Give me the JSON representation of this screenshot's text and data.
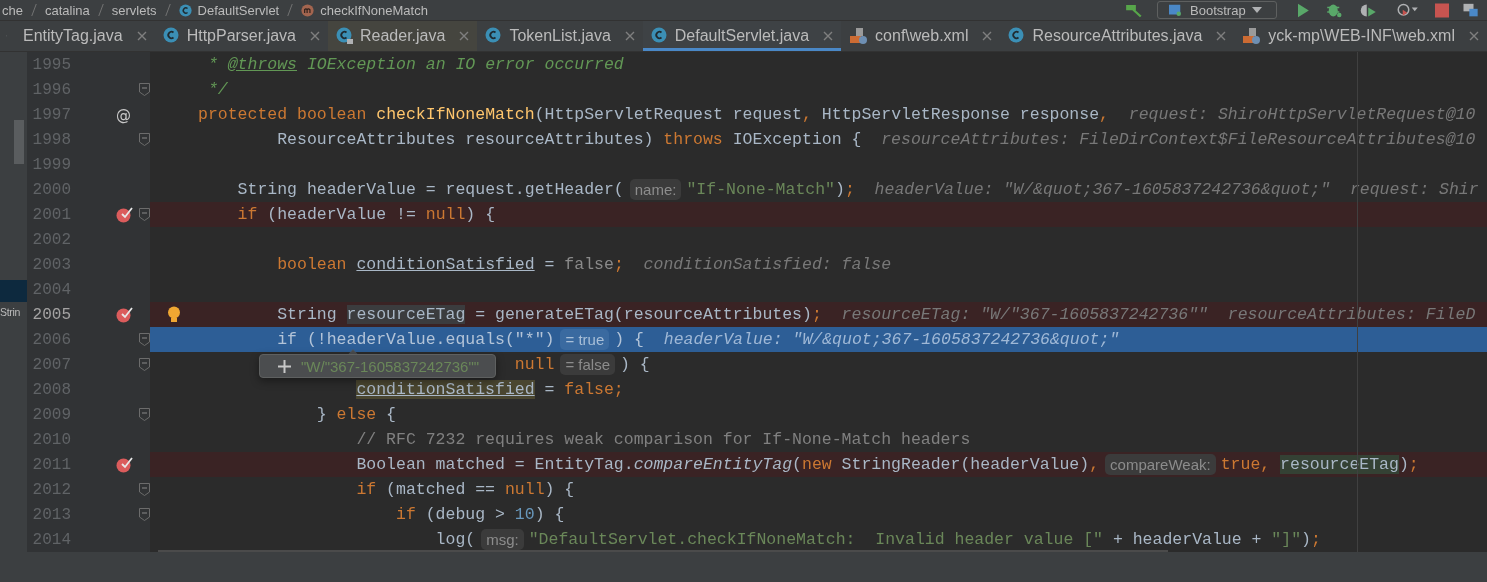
{
  "breadcrumb": [
    {
      "label": "che",
      "kind": "package"
    },
    {
      "label": "catalina",
      "kind": "package"
    },
    {
      "label": "servlets",
      "kind": "package"
    },
    {
      "label": "DefaultServlet",
      "kind": "class"
    },
    {
      "label": "checkIfNoneMatch",
      "kind": "method"
    }
  ],
  "run_config": {
    "label": "Bootstrap"
  },
  "tabs": [
    {
      "label": "EntityTag.java",
      "selected": false,
      "color": "#3c3f41"
    },
    {
      "label": "HttpParser.java",
      "kind": "class",
      "selected": false,
      "color": "#3c3f41"
    },
    {
      "label": "Reader.java",
      "kind": "class-locked",
      "selected": false,
      "color": "#45453f"
    },
    {
      "label": "TokenList.java",
      "kind": "class",
      "selected": false,
      "color": "#3c3f41"
    },
    {
      "label": "DefaultServlet.java",
      "kind": "class",
      "selected": true,
      "color": "#3e4245"
    },
    {
      "label": "conf\\web.xml",
      "kind": "xml",
      "selected": false,
      "color": "#3c3f41"
    },
    {
      "label": "ResourceAttributes.java",
      "kind": "class",
      "selected": false,
      "color": "#3c3f41"
    },
    {
      "label": "yck-mp\\WEB-INF\\web.xml",
      "kind": "xml",
      "selected": false,
      "color": "#3c3f41"
    }
  ],
  "side_panel": {
    "text": "Strin"
  },
  "lines": [
    {
      "number": "1995",
      "breakpoint": false,
      "current": false,
      "caret": false,
      "fold": false,
      "bulb": false,
      "tokens": [
        {
          "text": " * ",
          "kind": "doc"
        },
        {
          "text": "@throws",
          "kind": "doctag"
        },
        {
          "text": " IOException an IO error occurred",
          "kind": "doc"
        }
      ]
    },
    {
      "number": "1996",
      "breakpoint": false,
      "current": false,
      "caret": false,
      "fold": true,
      "bulb": false,
      "tokens": [
        {
          "text": " */",
          "kind": "doc"
        }
      ]
    },
    {
      "number": "1997",
      "marker": "@",
      "breakpoint": false,
      "current": false,
      "caret": false,
      "fold": false,
      "bulb": false,
      "tokens": [
        {
          "text": "protected boolean ",
          "kind": "kw"
        },
        {
          "text": "checkIfNoneMatch",
          "kind": "fn"
        },
        {
          "text": "(HttpServletRequest request",
          "kind": "plain"
        },
        {
          "text": ",",
          "kind": "kw"
        },
        {
          "text": " HttpServletResponse response",
          "kind": "plain"
        },
        {
          "text": ",",
          "kind": "kw"
        },
        {
          "text": "request: ShiroHttpServletRequest@10",
          "kind": "hint"
        }
      ]
    },
    {
      "number": "1998",
      "breakpoint": false,
      "current": false,
      "caret": false,
      "fold": true,
      "bulb": false,
      "tokens": [
        {
          "text": "        ResourceAttributes resourceAttributes) ",
          "kind": "plain"
        },
        {
          "text": "throws",
          "kind": "kw"
        },
        {
          "text": " IOException {",
          "kind": "plain"
        },
        {
          "text": "resourceAttributes: FileDirContext$FileResourceAttributes@10",
          "kind": "hint"
        }
      ]
    },
    {
      "number": "1999",
      "breakpoint": false,
      "current": false,
      "caret": false,
      "fold": false,
      "bulb": false
    },
    {
      "number": "2000",
      "breakpoint": false,
      "current": false,
      "caret": false,
      "fold": false,
      "bulb": false,
      "tokens": [
        {
          "text": "    String headerValue = request.getHeader(",
          "kind": "plain"
        },
        {
          "text": "name:",
          "kind": "inlay"
        },
        {
          "text": "\"If-None-Match\"",
          "kind": "str"
        },
        {
          "text": ")",
          "kind": "plain"
        },
        {
          "text": ";",
          "kind": "kw"
        },
        {
          "text": "headerValue: \"W/&quot;367-1605837242736&quot;\"",
          "kind": "hint"
        },
        {
          "text": "request: Shir",
          "kind": "hint"
        }
      ]
    },
    {
      "number": "2001",
      "breakpoint": true,
      "current": false,
      "caret": false,
      "fold": true,
      "bulb": false,
      "tokens": [
        {
          "text": "    if",
          "kind": "kw"
        },
        {
          "text": " (headerValue != ",
          "kind": "plain"
        },
        {
          "text": "null",
          "kind": "kw"
        },
        {
          "text": ") {",
          "kind": "plain"
        }
      ]
    },
    {
      "number": "2002",
      "breakpoint": false,
      "current": false,
      "caret": false,
      "fold": false,
      "bulb": false
    },
    {
      "number": "2003",
      "breakpoint": false,
      "current": false,
      "caret": false,
      "fold": false,
      "bulb": false,
      "tokens": [
        {
          "text": "        boolean ",
          "kind": "kw"
        },
        {
          "text": "conditionSatisfied",
          "kind": "var"
        },
        {
          "text": " = ",
          "kind": "plain"
        },
        {
          "text": "false",
          "kind": "dim"
        },
        {
          "text": ";",
          "kind": "kw"
        },
        {
          "text": "conditionSatisfied: false",
          "kind": "hint"
        }
      ]
    },
    {
      "number": "2004",
      "breakpoint": false,
      "current": false,
      "caret": false,
      "fold": false,
      "bulb": false
    },
    {
      "number": "2005",
      "breakpoint": true,
      "current": false,
      "caret": true,
      "fold": false,
      "bulb": true,
      "tokens": [
        {
          "text": "        String ",
          "kind": "plain"
        },
        {
          "text": "resourceETag",
          "kind": "selvar"
        },
        {
          "text": " = generateETag(resourceAttributes)",
          "kind": "plain"
        },
        {
          "text": ";",
          "kind": "kw"
        },
        {
          "text": "resourceETag: \"W/\"367-1605837242736\"\"",
          "kind": "hint"
        },
        {
          "text": "resourceAttributes: FileD",
          "kind": "hint"
        }
      ]
    },
    {
      "number": "2006",
      "breakpoint": false,
      "current": true,
      "caret": false,
      "fold": true,
      "bulb": false,
      "tokens": [
        {
          "text": "        if",
          "kind": "kw"
        },
        {
          "text": " (!headerValue.equals(",
          "kind": "plain"
        },
        {
          "text": "\"*\"",
          "kind": "str"
        },
        {
          "text": ")",
          "kind": "plain"
        },
        {
          "text": "= true",
          "kind": "inlay"
        },
        {
          "text": ") {",
          "kind": "plain"
        },
        {
          "text": "headerValue: \"W/&quot;367-1605837242736&quot;\"",
          "kind": "hint"
        }
      ]
    },
    {
      "number": "2007",
      "breakpoint": false,
      "current": false,
      "caret": false,
      "fold": true,
      "bulb": false,
      "tokens": [
        {
          "text": "                                null",
          "kind": "kw"
        },
        {
          "text": "= false",
          "kind": "inlay"
        },
        {
          "text": ") {",
          "kind": "plain"
        }
      ]
    },
    {
      "number": "2008",
      "breakpoint": false,
      "current": false,
      "caret": false,
      "fold": false,
      "bulb": false,
      "tokens": [
        {
          "text": "                conditionSatisfied",
          "kind": "write"
        },
        {
          "text": " = ",
          "kind": "plain"
        },
        {
          "text": "false;",
          "kind": "kw"
        }
      ]
    },
    {
      "number": "2009",
      "breakpoint": false,
      "current": false,
      "caret": false,
      "fold": true,
      "bulb": false,
      "tokens": [
        {
          "text": "            } ",
          "kind": "plain"
        },
        {
          "text": "else",
          "kind": "kw"
        },
        {
          "text": " {",
          "kind": "plain"
        }
      ]
    },
    {
      "number": "2010",
      "breakpoint": false,
      "current": false,
      "caret": false,
      "fold": false,
      "bulb": false,
      "tokens": [
        {
          "text": "                // RFC 7232 requires weak comparison for If-None-Match headers",
          "kind": "comment"
        }
      ]
    },
    {
      "number": "2011",
      "breakpoint": true,
      "current": false,
      "caret": false,
      "fold": false,
      "bulb": false,
      "tokens": [
        {
          "text": "                Boolean matched = EntityTag.",
          "kind": "plain"
        },
        {
          "text": "compareEntityTag",
          "kind": "static"
        },
        {
          "text": "(",
          "kind": "plain"
        },
        {
          "text": "new",
          "kind": "kw"
        },
        {
          "text": " StringReader(headerValue)",
          "kind": "plain"
        },
        {
          "text": ",",
          "kind": "kw"
        },
        {
          "text": "compareWeak:",
          "kind": "inlay"
        },
        {
          "text": "true, ",
          "kind": "kw"
        },
        {
          "text": "resourceETag",
          "kind": "usage"
        },
        {
          "text": ")",
          "kind": "plain"
        },
        {
          "text": ";",
          "kind": "kw"
        }
      ]
    },
    {
      "number": "2012",
      "breakpoint": false,
      "current": false,
      "caret": false,
      "fold": true,
      "bulb": false,
      "tokens": [
        {
          "text": "                if",
          "kind": "kw"
        },
        {
          "text": " (matched == ",
          "kind": "plain"
        },
        {
          "text": "null",
          "kind": "kw"
        },
        {
          "text": ") {",
          "kind": "plain"
        }
      ]
    },
    {
      "number": "2013",
      "breakpoint": false,
      "current": false,
      "caret": false,
      "fold": true,
      "bulb": false,
      "tokens": [
        {
          "text": "                    if",
          "kind": "kw"
        },
        {
          "text": " (debug > ",
          "kind": "plain"
        },
        {
          "text": "10",
          "kind": "num"
        },
        {
          "text": ") {",
          "kind": "plain"
        }
      ]
    },
    {
      "number": "2014",
      "breakpoint": false,
      "current": false,
      "caret": false,
      "fold": false,
      "bulb": false,
      "tokens": [
        {
          "text": "                        log(",
          "kind": "plain"
        },
        {
          "text": "msg:",
          "kind": "inlay"
        },
        {
          "text": "\"DefaultServlet.checkIfNoneMatch:  Invalid header value [\"",
          "kind": "str"
        },
        {
          "text": " + headerValue + ",
          "kind": "plain"
        },
        {
          "text": "\"]\"",
          "kind": "str"
        },
        {
          "text": ")",
          "kind": "plain"
        },
        {
          "text": ";",
          "kind": "kw"
        }
      ]
    }
  ],
  "tooltip": {
    "value": "\"W/\"367-1605837242736\"\""
  }
}
